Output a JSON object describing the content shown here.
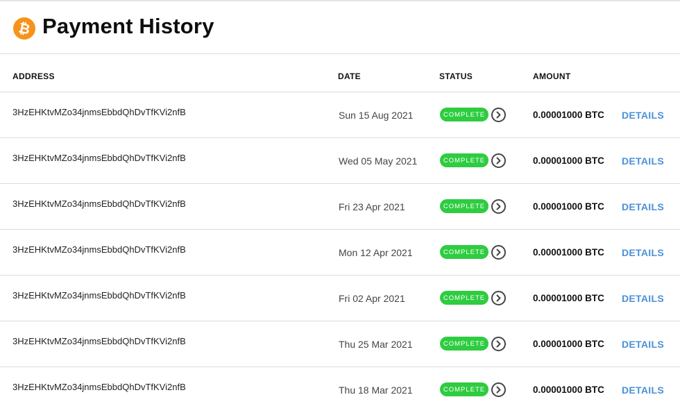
{
  "header": {
    "logo_icon": "bitcoin-icon",
    "logo_glyph": "₿",
    "title": "Payment History"
  },
  "table": {
    "columns": {
      "address": "ADDRESS",
      "date": "DATE",
      "status": "STATUS",
      "amount": "AMOUNT"
    },
    "rows": [
      {
        "address": "3HzEHKtvMZo34jnmsEbbdQhDvTfKVi2nfB",
        "date": "Sun 15 Aug 2021",
        "status": "COMPLETE",
        "amount": "0.00001000 BTC",
        "action": "DETAILS"
      },
      {
        "address": "3HzEHKtvMZo34jnmsEbbdQhDvTfKVi2nfB",
        "date": "Wed 05 May 2021",
        "status": "COMPLETE",
        "amount": "0.00001000 BTC",
        "action": "DETAILS"
      },
      {
        "address": "3HzEHKtvMZo34jnmsEbbdQhDvTfKVi2nfB",
        "date": "Fri 23 Apr 2021",
        "status": "COMPLETE",
        "amount": "0.00001000 BTC",
        "action": "DETAILS"
      },
      {
        "address": "3HzEHKtvMZo34jnmsEbbdQhDvTfKVi2nfB",
        "date": "Mon 12 Apr 2021",
        "status": "COMPLETE",
        "amount": "0.00001000 BTC",
        "action": "DETAILS"
      },
      {
        "address": "3HzEHKtvMZo34jnmsEbbdQhDvTfKVi2nfB",
        "date": "Fri 02 Apr 2021",
        "status": "COMPLETE",
        "amount": "0.00001000 BTC",
        "action": "DETAILS"
      },
      {
        "address": "3HzEHKtvMZo34jnmsEbbdQhDvTfKVi2nfB",
        "date": "Thu 25 Mar 2021",
        "status": "COMPLETE",
        "amount": "0.00001000 BTC",
        "action": "DETAILS"
      },
      {
        "address": "3HzEHKtvMZo34jnmsEbbdQhDvTfKVi2nfB",
        "date": "Thu 18 Mar 2021",
        "status": "COMPLETE",
        "amount": "0.00001000 BTC",
        "action": "DETAILS"
      }
    ]
  },
  "colors": {
    "bitcoin_orange": "#f7931a",
    "status_complete_green": "#2ecc40",
    "details_link_blue": "#4a90d9",
    "divider": "#dcdcdc"
  }
}
